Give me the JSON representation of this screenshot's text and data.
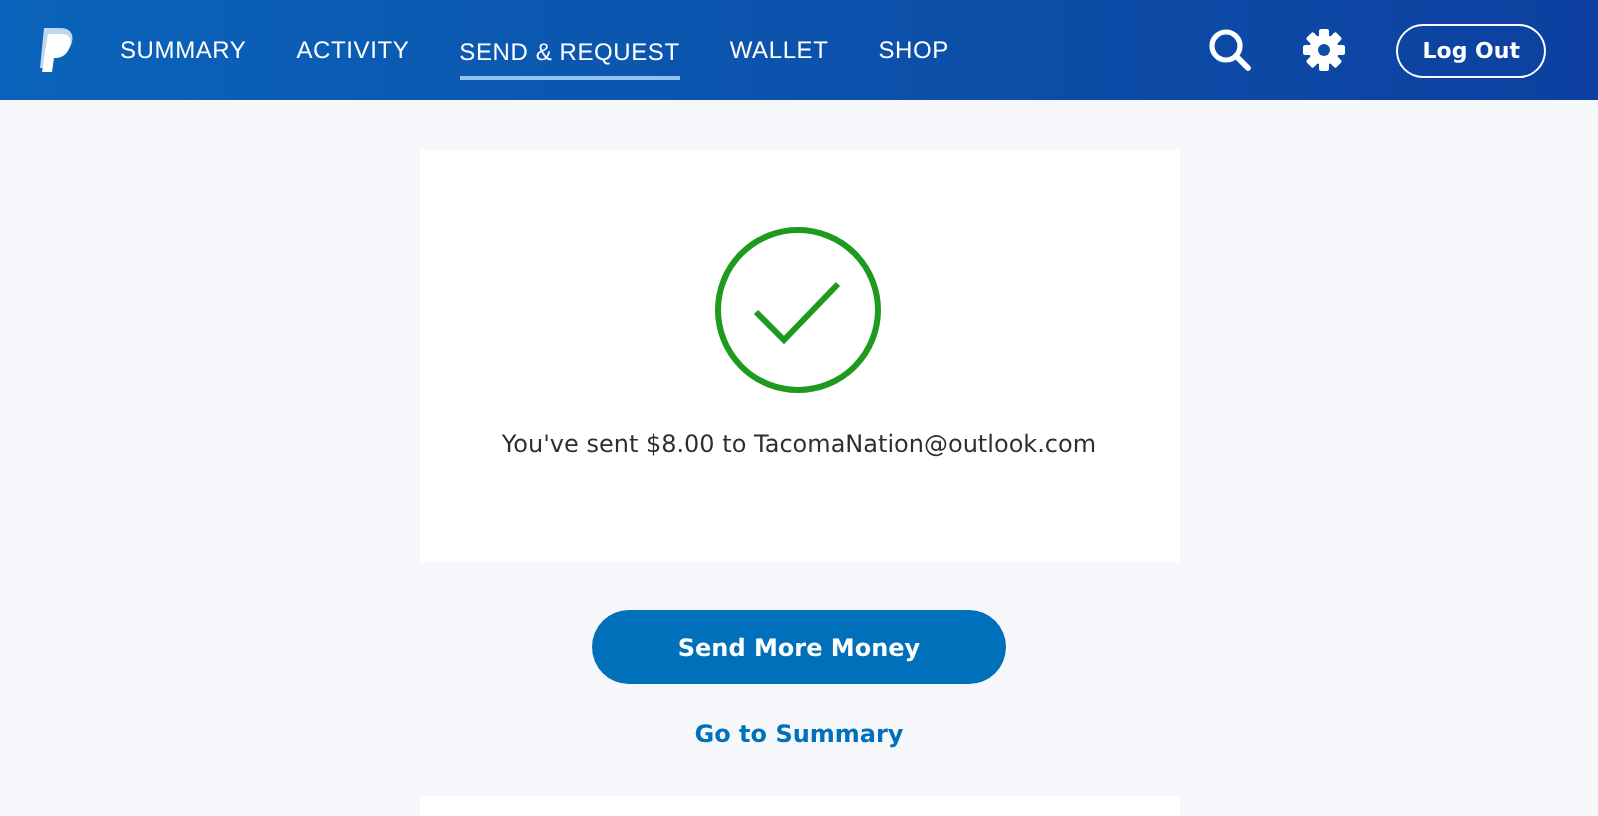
{
  "nav": [
    {
      "label": "SUMMARY",
      "selected": false
    },
    {
      "label": "ACTIVITY",
      "selected": false
    },
    {
      "label": "SEND & REQUEST",
      "selected": true
    },
    {
      "label": "WALLET",
      "selected": false
    },
    {
      "label": "SHOP",
      "selected": false
    }
  ],
  "logout": "Log Out",
  "confirmation": {
    "message": "You've sent $8.00 to TacomaNation@outlook.com"
  },
  "primary_button": "Send More Money",
  "link": "Go to Summary"
}
